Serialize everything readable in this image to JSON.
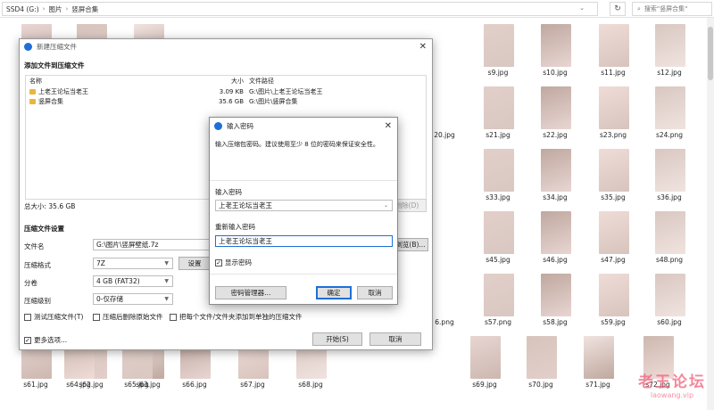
{
  "explorer": {
    "breadcrumb": [
      "SSD4 (G:)",
      "图片",
      "竖屏合集"
    ],
    "refresh_icon": "refresh-icon",
    "search_placeholder": "搜索\"竖屏合集\"",
    "rows": [
      {
        "left": [
          "",
          "",
          ""
        ],
        "right": [
          "",
          "s9.jpg",
          "s10.jpg",
          "s11.jpg",
          "s12.jpg"
        ]
      },
      {
        "left": [
          "",
          "",
          ""
        ],
        "right": [
          "20.jpg",
          "s21.jpg",
          "s22.jpg",
          "s23.png",
          "s24.png"
        ]
      },
      {
        "left": [
          "",
          "",
          ""
        ],
        "right": [
          "",
          "s33.jpg",
          "s34.jpg",
          "s35.jpg",
          "s36.jpg"
        ]
      },
      {
        "left": [
          "",
          "",
          ""
        ],
        "right": [
          "",
          "s45.jpg",
          "s46.jpg",
          "s47.jpg",
          "s48.png"
        ]
      },
      {
        "left": [
          "",
          "",
          ""
        ],
        "right": [
          "6.png",
          "s57.png",
          "s58.jpg",
          "s59.jpg",
          "s60.jpg"
        ]
      },
      {
        "left": [
          "s61.jpg",
          "s62.jpg",
          "s63.jpg"
        ],
        "mid": [
          "s64.jpg",
          "s65.jpg",
          "s66.jpg",
          "s67.jpg",
          "s68.jpg"
        ],
        "right": [
          "s69.jpg",
          "s70.jpg",
          "s71.jpg",
          "s72.jpg"
        ]
      }
    ],
    "partial_labels": {
      "r0": "8.jpg",
      "r2": ".jpg",
      "r3": "jpg"
    }
  },
  "archive": {
    "title": "新建压缩文件",
    "section_add": "添加文件到压缩文件",
    "col_name": "名称",
    "col_size": "大小",
    "col_path": "文件路径",
    "files": [
      {
        "name": "上老王论坛当老王",
        "size": "3.09 KB",
        "path": "G:\\图片\\上老王论坛当老王"
      },
      {
        "name": "竖屏合集",
        "size": "35.6 GB",
        "path": "G:\\图片\\竖屏合集"
      }
    ],
    "total": "总大小: 35.6 GB",
    "delete_btn": "删除(D)",
    "section_settings": "压缩文件设置",
    "filename_label": "文件名",
    "filename_value": "G:\\图片\\竖屏壁纸.7z",
    "browse_btn": "浏览(B)...",
    "format_label": "压缩格式",
    "format_value": "7Z",
    "settings_btn": "设置",
    "split_label": "分卷",
    "split_value": "4 GB (FAT32)",
    "level_label": "压缩级别",
    "level_value": "0-仅存储",
    "test_label": "测试压缩文件(T)",
    "delete_after_label": "压缩后删除原始文件",
    "separate_label": "把每个文件/文件夹添加到单独的压缩文件",
    "more_label": "更多选项...",
    "start_btn": "开始(S)",
    "cancel_btn": "取消"
  },
  "password": {
    "title": "输入密码",
    "hint": "输入压缩包密码。建议使用至少 8 位的密码来保证安全性。",
    "label1": "输入密码",
    "value1": "上老王论坛当老王",
    "label2": "重新输入密码",
    "value2": "上老王论坛当老王",
    "show_label": "显示密码",
    "manager_btn": "密码管理器...",
    "ok_btn": "确定",
    "cancel_btn": "取消"
  },
  "watermark": {
    "line1": "老王论坛",
    "line2": "laowang.vip"
  },
  "colors": {
    "accent": "#1f6fd6",
    "folder": "#e8b83c",
    "watermark": "#f0607a"
  }
}
